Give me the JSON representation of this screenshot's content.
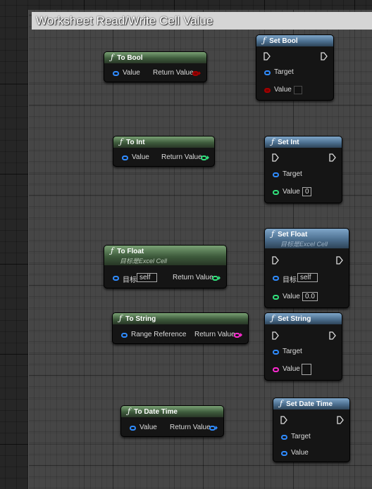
{
  "comment": {
    "title": "Worksheet Read/Write Cell Value"
  },
  "nodes": {
    "to_bool": {
      "title": "To Bool",
      "in_label": "Value",
      "out_label": "Return Value"
    },
    "set_bool": {
      "title": "Set Bool",
      "target_label": "Target",
      "value_label": "Value"
    },
    "to_int": {
      "title": "To Int",
      "in_label": "Value",
      "out_label": "Return Value"
    },
    "set_int": {
      "title": "Set Int",
      "target_label": "Target",
      "value_label": "Value",
      "value": "0"
    },
    "to_float": {
      "title": "To Float",
      "subtitle": "目标是Excel Cell",
      "target_label": "目标",
      "target_value": "self",
      "out_label": "Return Value"
    },
    "set_float": {
      "title": "Set Float",
      "subtitle": "目标是Excel Cell",
      "target_label": "目标",
      "target_value": "self",
      "value_label": "Value",
      "value": "0.0"
    },
    "to_string": {
      "title": "To String",
      "in_label": "Range Reference",
      "out_label": "Return Value"
    },
    "set_string": {
      "title": "Set String",
      "target_label": "Target",
      "value_label": "Value",
      "value": ""
    },
    "to_datetime": {
      "title": "To Date Time",
      "in_label": "Value",
      "out_label": "Return Value"
    },
    "set_datetime": {
      "title": "Set Date Time",
      "target_label": "Target",
      "value_label": "Value"
    }
  },
  "icons": {
    "function": "function-icon",
    "exec": "exec-pin-icon"
  },
  "colors": {
    "pure_node_header": "#4e704b",
    "impure_node_header": "#567b9c",
    "struct_pin": "#2f8bff",
    "bool_pin": "#a30000",
    "int_pin": "#31e07c",
    "string_pin": "#ff2bd1",
    "comment_title_bg": "#d5d5d5"
  }
}
